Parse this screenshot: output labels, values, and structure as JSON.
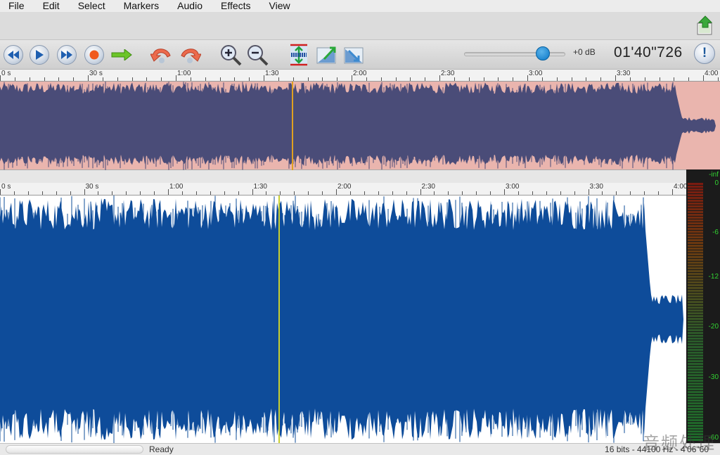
{
  "menu": [
    "File",
    "Edit",
    "Select",
    "Markers",
    "Audio",
    "Effects",
    "View"
  ],
  "toolbar": {
    "icons": [
      "rewind-icon",
      "play-icon",
      "fast-forward-icon",
      "record-icon",
      "arrow-right-icon",
      "undo-icon",
      "redo-icon",
      "zoom-in-icon",
      "zoom-out-icon",
      "zoom-fit-icon",
      "fade-in-icon",
      "fade-out-icon"
    ],
    "volume_level": 0.78,
    "volume_db": "+0 dB",
    "time": "01'40\"726",
    "info_symbol": "!"
  },
  "ruler_labels": [
    "0 s",
    "30 s",
    "1:00",
    "1:30",
    "2:00",
    "2:30",
    "3:00",
    "3:30",
    "4:00"
  ],
  "vu_labels": [
    "-inf",
    "0",
    "-6",
    "-12",
    "-20",
    "-30",
    "-60"
  ],
  "colors": {
    "overview_wave": "#4a4c78",
    "overview_bg": "#eab5ae",
    "main_wave": "#0e4c9a",
    "overview_cursor": "#e0a020",
    "main_cursor": "#c8d030"
  },
  "status": {
    "text": "Ready",
    "format": "16 bits - 44100 Hz - 4'06\"60"
  },
  "watermark": "音频处理"
}
